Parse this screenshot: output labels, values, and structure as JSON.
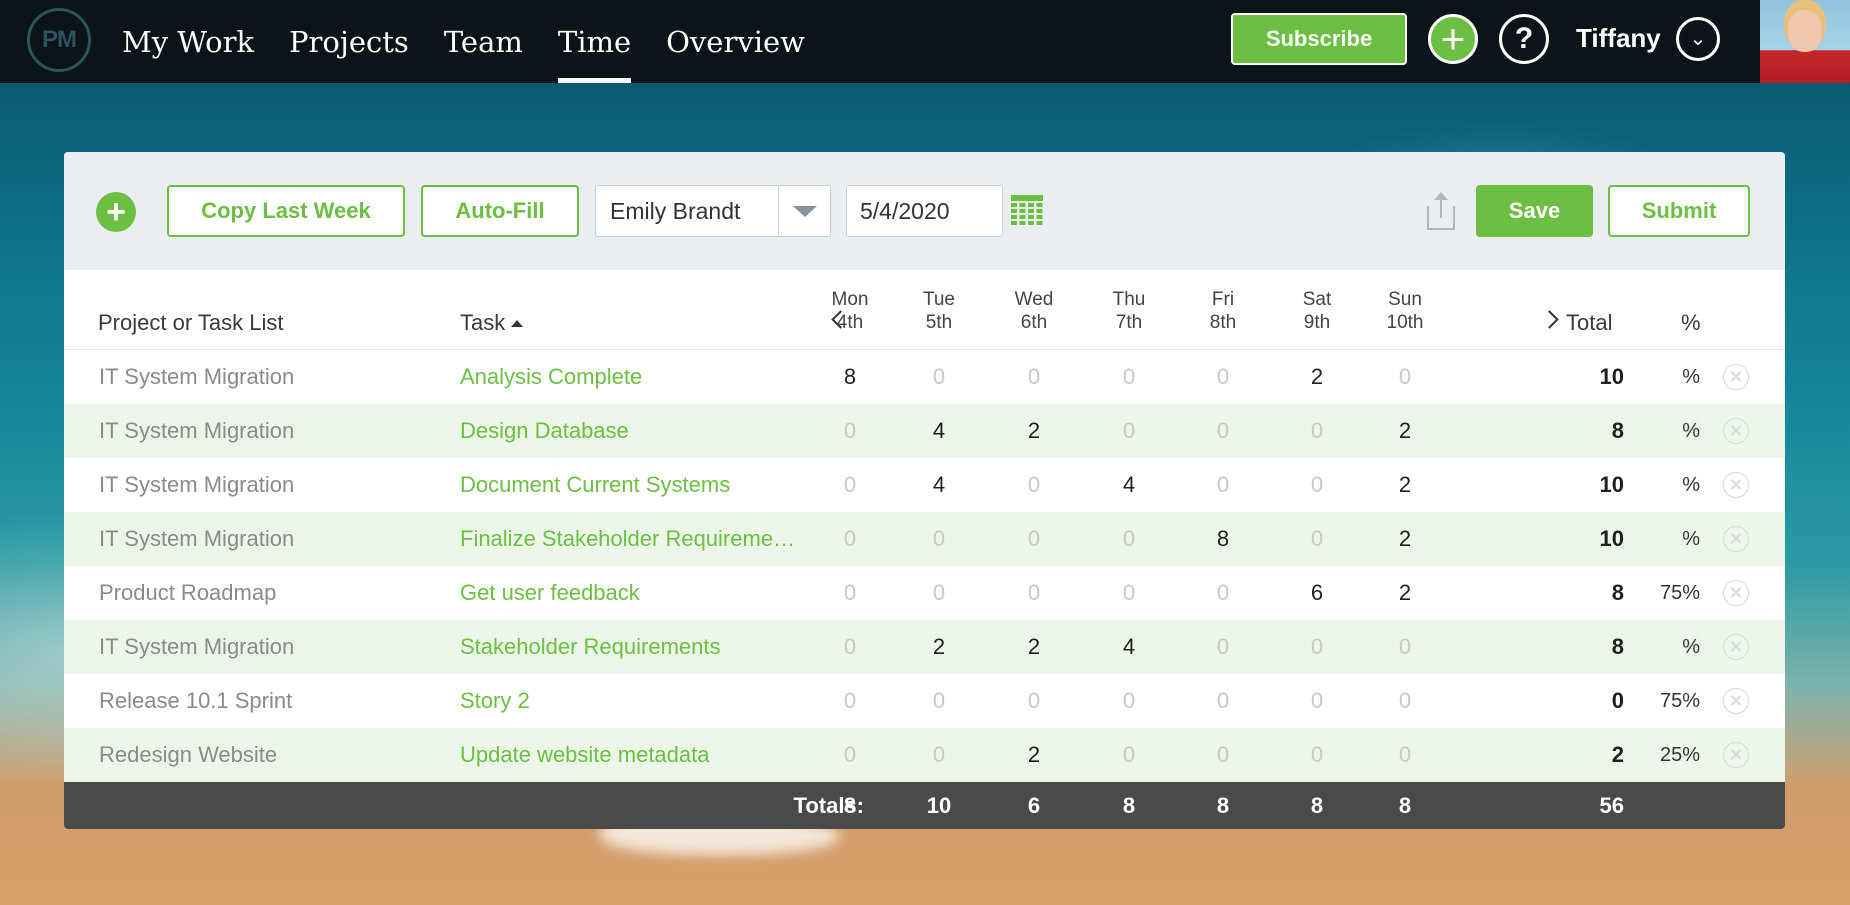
{
  "app": {
    "logo_text": "PM"
  },
  "nav": {
    "items": [
      {
        "label": "My Work",
        "active": false
      },
      {
        "label": "Projects",
        "active": false
      },
      {
        "label": "Team",
        "active": false
      },
      {
        "label": "Time",
        "active": true
      },
      {
        "label": "Overview",
        "active": false
      }
    ]
  },
  "header": {
    "subscribe_label": "Subscribe",
    "add_icon": "plus-icon",
    "help_label": "?",
    "user_name": "Tiffany",
    "user_menu_icon": "chevron-down-icon"
  },
  "toolbar": {
    "add_icon": "plus-icon",
    "copy_last_week_label": "Copy Last Week",
    "auto_fill_label": "Auto-Fill",
    "person_value": "Emily Brandt",
    "date_value": "5/4/2020",
    "save_label": "Save",
    "submit_label": "Submit"
  },
  "table": {
    "headers": {
      "project": "Project or Task List",
      "task": "Task",
      "total": "Total",
      "percent": "%"
    },
    "days": [
      {
        "name": "Mon",
        "date": "4th"
      },
      {
        "name": "Tue",
        "date": "5th"
      },
      {
        "name": "Wed",
        "date": "6th"
      },
      {
        "name": "Thu",
        "date": "7th"
      },
      {
        "name": "Fri",
        "date": "8th"
      },
      {
        "name": "Sat",
        "date": "9th"
      },
      {
        "name": "Sun",
        "date": "10th"
      }
    ],
    "rows": [
      {
        "project": "IT System Migration",
        "task": "Analysis Complete",
        "hours": [
          "8",
          "0",
          "0",
          "0",
          "0",
          "2",
          "0"
        ],
        "total": "10",
        "percent": "%"
      },
      {
        "project": "IT System Migration",
        "task": "Design Database",
        "hours": [
          "0",
          "4",
          "2",
          "0",
          "0",
          "0",
          "2"
        ],
        "total": "8",
        "percent": "%"
      },
      {
        "project": "IT System Migration",
        "task": "Document Current Systems",
        "hours": [
          "0",
          "4",
          "0",
          "4",
          "0",
          "0",
          "2"
        ],
        "total": "10",
        "percent": "%"
      },
      {
        "project": "IT System Migration",
        "task": "Finalize Stakeholder Requireme…",
        "hours": [
          "0",
          "0",
          "0",
          "0",
          "8",
          "0",
          "2"
        ],
        "total": "10",
        "percent": "%"
      },
      {
        "project": "Product Roadmap",
        "task": "Get user feedback",
        "hours": [
          "0",
          "0",
          "0",
          "0",
          "0",
          "6",
          "2"
        ],
        "total": "8",
        "percent": "75%"
      },
      {
        "project": "IT System Migration",
        "task": "Stakeholder Requirements",
        "hours": [
          "0",
          "2",
          "2",
          "4",
          "0",
          "0",
          "0"
        ],
        "total": "8",
        "percent": "%"
      },
      {
        "project": "Release 10.1 Sprint",
        "task": "Story 2",
        "hours": [
          "0",
          "0",
          "0",
          "0",
          "0",
          "0",
          "0"
        ],
        "total": "0",
        "percent": "75%"
      },
      {
        "project": "Redesign Website",
        "task": "Update website metadata",
        "hours": [
          "0",
          "0",
          "2",
          "0",
          "0",
          "0",
          "0"
        ],
        "total": "2",
        "percent": "25%"
      }
    ],
    "totals": {
      "label": "Totals:",
      "days": [
        "8",
        "10",
        "6",
        "8",
        "8",
        "8",
        "8"
      ],
      "grand_total": "56"
    }
  },
  "colors": {
    "accent": "#6cbf42",
    "topbar": "#0b1418",
    "totals_bar": "#4a4a4a",
    "alt_row": "#ecf6e8"
  }
}
